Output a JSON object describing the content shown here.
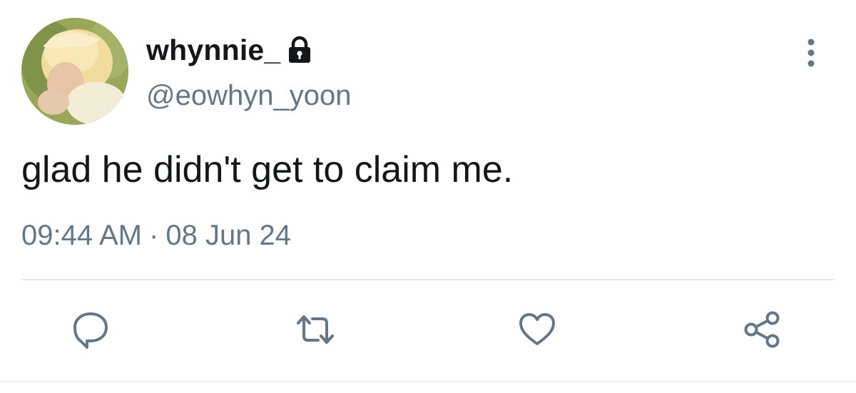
{
  "user": {
    "display_name": "whynnie_",
    "handle": "@eowhyn_yoon",
    "protected_icon": "lock-icon",
    "avatar": "profile-photo"
  },
  "tweet": {
    "text": "glad he didn't get to claim me.",
    "time": "09:44 AM",
    "separator": "·",
    "date": "08 Jun 24"
  },
  "actions": [
    {
      "icon": "reply-icon"
    },
    {
      "icon": "retweet-icon"
    },
    {
      "icon": "like-icon"
    },
    {
      "icon": "share-icon"
    }
  ],
  "menu": {
    "icon": "more-vertical-icon"
  },
  "colors": {
    "text": "#14171a",
    "secondary": "#657786",
    "divider": "#e1e8ed",
    "background": "#ffffff"
  }
}
